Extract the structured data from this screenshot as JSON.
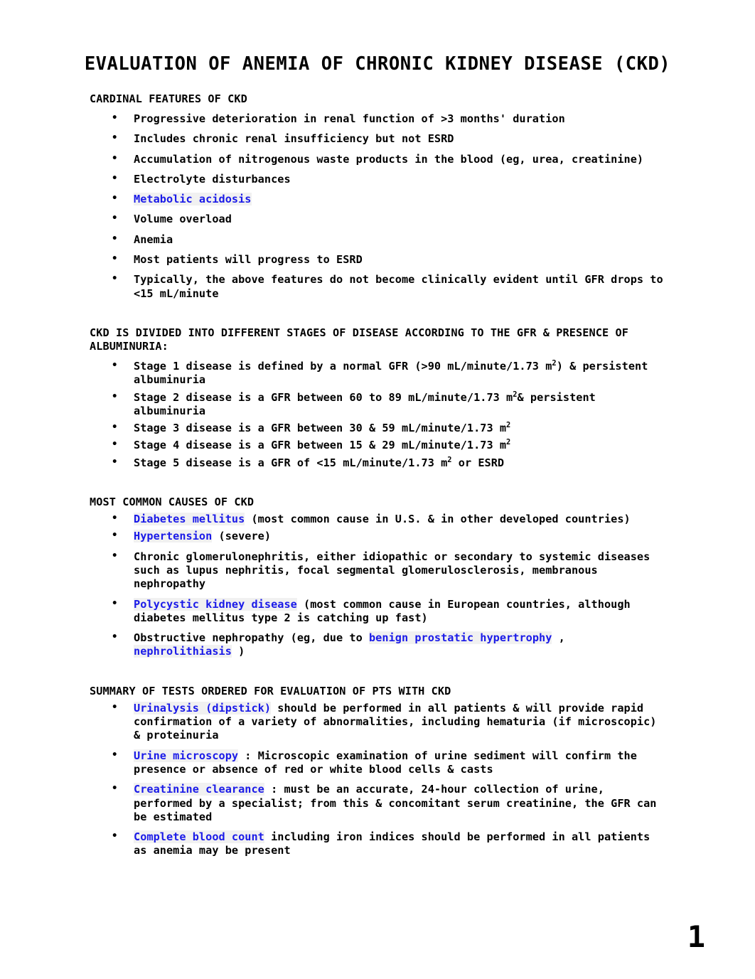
{
  "document": {
    "title": "EVALUATION OF ANEMIA OF CHRONIC KIDNEY DISEASE (CKD)",
    "page_number": "1",
    "link_color": "#1a1ae8",
    "link_highlight_color": "#f1f1f1",
    "text_color": "#000000",
    "background_color": "#ffffff"
  },
  "sections": [
    {
      "heading": "CARDINAL FEATURES OF CKD",
      "bullets": [
        {
          "text": "Progressive deterioration in renal function of >3 months' duration"
        },
        {
          "text": "Includes chronic renal insufficiency but not ESRD"
        },
        {
          "text": "Accumulation of nitrogenous waste products in the blood (eg, urea, creatinine)"
        },
        {
          "text": "Electrolyte disturbances"
        },
        {
          "link": "Metabolic acidosis",
          "text": ""
        },
        {
          "text": "Volume overload"
        },
        {
          "text": "Anemia"
        },
        {
          "text": "Most patients will progress to ESRD"
        },
        {
          "text": "Typically, the above features do not become clinically evident until GFR drops to <15 mL/minute"
        }
      ]
    },
    {
      "heading": "CKD IS DIVIDED INTO DIFFERENT STAGES OF DISEASE ACCORDING TO THE GFR & PRESENCE OF ALBUMINURIA:",
      "bullets": [
        {
          "pre": "Stage 1 disease is defined by a normal GFR (>90 mL/minute/1.73 m",
          "sup": "2",
          "post": ") & persistent albuminuria"
        },
        {
          "pre": "Stage 2 disease is a GFR between 60 to 89 mL/minute/1.73 m",
          "sup": "2",
          "post": "& persistent albuminuria"
        },
        {
          "pre": "Stage 3 disease is a GFR between 30 & 59 mL/minute/1.73 m",
          "sup": "2",
          "post": ""
        },
        {
          "pre": "Stage 4 disease is a GFR between 15 & 29 mL/minute/1.73 m",
          "sup": "2",
          "post": ""
        },
        {
          "pre": "Stage 5 disease is a GFR of <15 mL/minute/1.73 m",
          "sup": "2",
          "post": " or ESRD"
        }
      ]
    },
    {
      "heading": "MOST COMMON CAUSES OF CKD",
      "bullets": [
        {
          "link": "Diabetes mellitus",
          "text": " (most common cause in U.S. & in other developed countries)"
        },
        {
          "link": "Hypertension",
          "text": " (severe)"
        },
        {
          "text": "Chronic glomerulonephritis, either idiopathic or secondary to systemic diseases such as lupus nephritis, focal segmental glomerulosclerosis, membranous nephropathy"
        },
        {
          "link": "Polycystic kidney disease",
          "text": " (most common cause in European countries, although diabetes mellitus type 2 is catching up fast)"
        },
        {
          "pre_text": "Obstructive nephropathy (eg, due to ",
          "link": "benign prostatic hypertrophy",
          "mid_text": " , ",
          "link2": "nephrolithiasis",
          "post_text": " )"
        }
      ]
    },
    {
      "heading": "SUMMARY OF TESTS ORDERED FOR EVALUATION OF PTS WITH CKD",
      "bullets": [
        {
          "link": "Urinalysis (dipstick)",
          "text": " should be performed in all patients & will provide rapid confirmation of a variety of abnormalities, including hematuria (if microscopic) & proteinuria"
        },
        {
          "link": "Urine microscopy",
          "text": " : Microscopic examination of urine sediment will confirm the presence or absence of red or white blood cells & casts"
        },
        {
          "link": "Creatinine clearance",
          "text": " : must be an accurate, 24-hour collection of urine, performed by a specialist; from this & concomitant serum creatinine, the GFR can be estimated"
        },
        {
          "link": "Complete blood count",
          "text": " including iron indices should be performed in all patients as anemia may be present"
        }
      ]
    }
  ]
}
